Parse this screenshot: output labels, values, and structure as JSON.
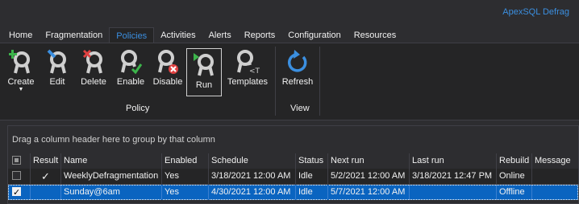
{
  "app": {
    "title": "ApexSQL Defrag"
  },
  "tabs": [
    {
      "label": "Home",
      "active": false
    },
    {
      "label": "Fragmentation",
      "active": false
    },
    {
      "label": "Policies",
      "active": true
    },
    {
      "label": "Activities",
      "active": false
    },
    {
      "label": "Alerts",
      "active": false
    },
    {
      "label": "Reports",
      "active": false
    },
    {
      "label": "Configuration",
      "active": false
    },
    {
      "label": "Resources",
      "active": false
    }
  ],
  "ribbon": {
    "policy_group": {
      "label": "Policy",
      "buttons": {
        "create": {
          "label": "Create",
          "icon": "create-policy-icon"
        },
        "edit": {
          "label": "Edit",
          "icon": "edit-policy-icon"
        },
        "delete": {
          "label": "Delete",
          "icon": "delete-policy-icon"
        },
        "enable": {
          "label": "Enable",
          "icon": "enable-policy-icon"
        },
        "disable": {
          "label": "Disable",
          "icon": "disable-policy-icon"
        },
        "run": {
          "label": "Run",
          "icon": "run-policy-icon"
        },
        "templates": {
          "label": "Templates",
          "icon": "templates-icon"
        }
      }
    },
    "view_group": {
      "label": "View",
      "buttons": {
        "refresh": {
          "label": "Refresh",
          "icon": "refresh-icon"
        }
      }
    }
  },
  "grid": {
    "group_panel_text": "Drag a column header here to group by that column",
    "columns": [
      "Result",
      "Name",
      "Enabled",
      "Schedule",
      "Status",
      "Next run",
      "Last run",
      "Rebuild",
      "Message"
    ],
    "rows": [
      {
        "selected": false,
        "checked": false,
        "result": "✓",
        "name": "WeeklyDefragmentation",
        "enabled": "Yes",
        "schedule": "3/18/2021 12:00 AM",
        "status": "Idle",
        "next_run": "5/2/2021 12:00 AM",
        "last_run": "3/18/2021 12:47 PM",
        "rebuild": "Online",
        "message": ""
      },
      {
        "selected": true,
        "checked": true,
        "result": "",
        "name": "Sunday@6am",
        "enabled": "Yes",
        "schedule": "4/30/2021 12:00 AM",
        "status": "Idle",
        "next_run": "5/7/2021 12:00 AM",
        "last_run": "",
        "rebuild": "Offline",
        "message": ""
      }
    ]
  },
  "colors": {
    "accent": "#3b8fe0",
    "selection": "#0a64c0",
    "background": "#2d2d30",
    "ribbon": "#252526"
  }
}
